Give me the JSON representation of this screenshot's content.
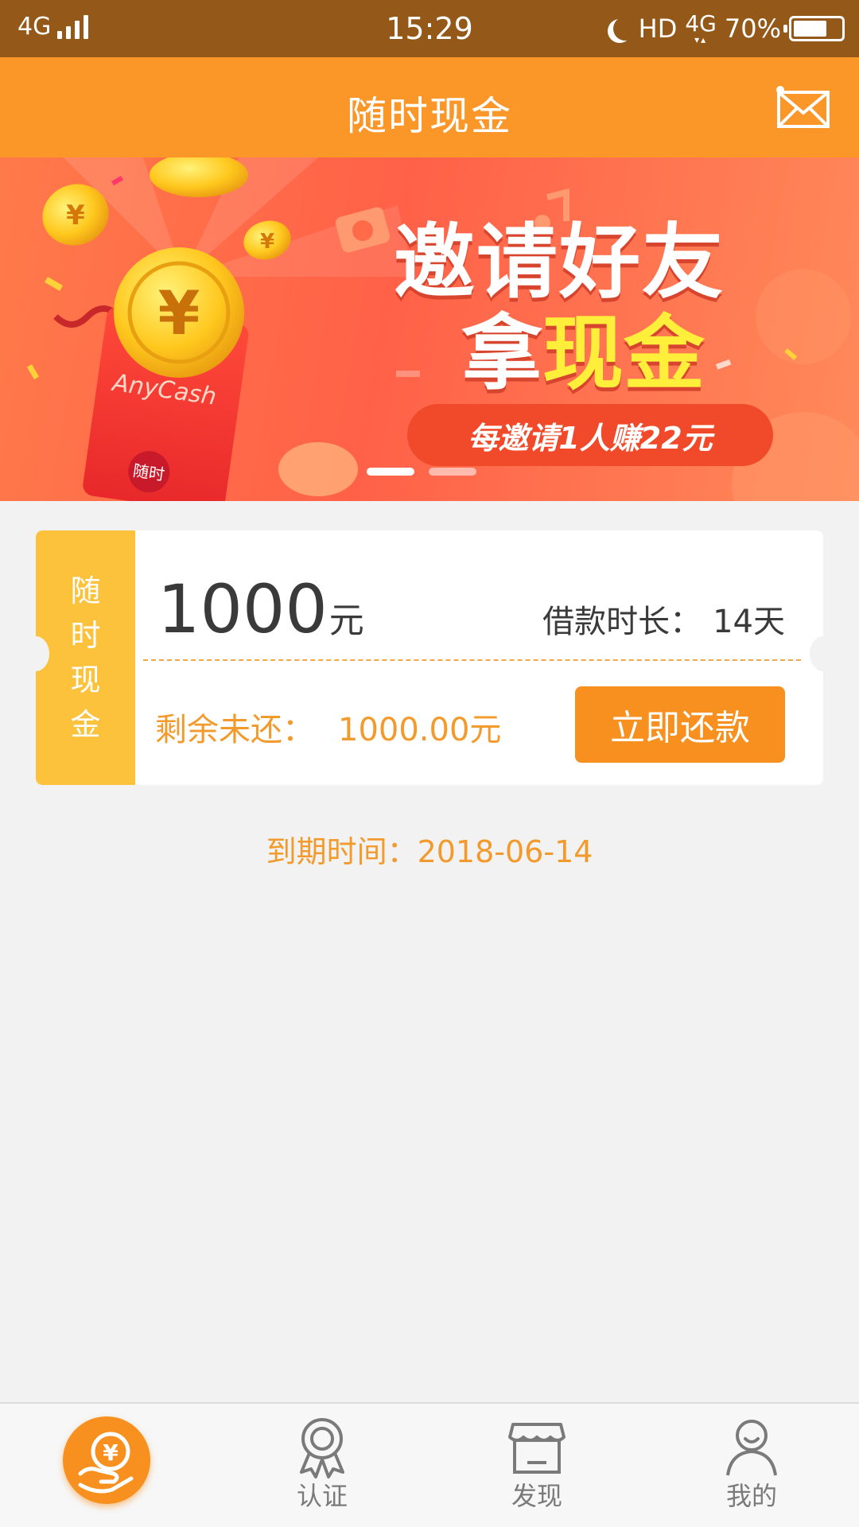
{
  "status_bar": {
    "network": "4G",
    "time": "15:29",
    "hd": "HD",
    "net_type": "4G",
    "battery": "70%",
    "battery_level": 0.7
  },
  "header": {
    "title": "随时现金",
    "mail_icon": "mail-icon"
  },
  "banner": {
    "headline": "邀请好友",
    "subline_prefix": "拿",
    "subline_highlight": "现金",
    "pill_text": "每邀请1人赚22元",
    "envelope_brand": "AnyCash",
    "envelope_seal": "随时",
    "slide_count": 2,
    "active_slide": 0
  },
  "loan_card": {
    "strip_chars": [
      "随",
      "时",
      "现",
      "金"
    ],
    "amount": "1000",
    "amount_unit": "元",
    "term_label": "借款时长：",
    "term_value": "14天",
    "remaining_label": "剩余未还：",
    "remaining_value": "1000.00元",
    "repay_button": "立即还款"
  },
  "due_date": "到期时间：2018-06-14",
  "bottom_nav": {
    "items": [
      {
        "label": "",
        "icon": "yuan-hand-icon",
        "active": true
      },
      {
        "label": "认证",
        "icon": "badge-icon",
        "active": false
      },
      {
        "label": "发现",
        "icon": "store-icon",
        "active": false
      },
      {
        "label": "我的",
        "icon": "user-icon",
        "active": false
      }
    ]
  },
  "colors": {
    "status_bar": "#945818",
    "accent": "#fb9628",
    "button": "#f7901e",
    "strip": "#fcc23c",
    "text_orange": "#f39a2c"
  }
}
